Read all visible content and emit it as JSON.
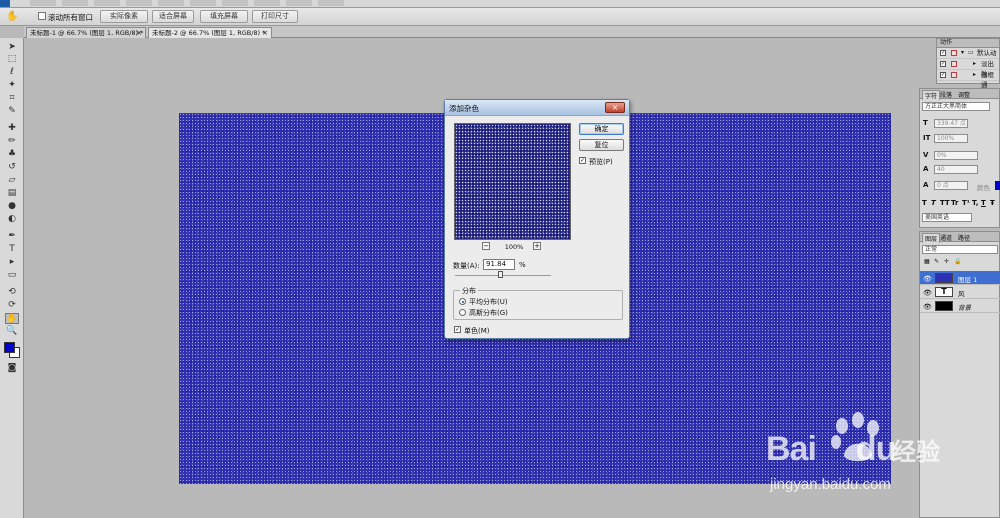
{
  "options_bar": {
    "scroll_all_windows_label": "滚动所有窗口",
    "buttons": [
      "实际像素",
      "适合屏幕",
      "填充屏幕",
      "打印尺寸"
    ]
  },
  "doc_tabs": [
    {
      "label": "未标题-1 @ 66.7% (图层 1, RGB/8) *",
      "close": "×"
    },
    {
      "label": "未标题-2 @ 66.7% (图层 1, RGB/8) *",
      "close": "×"
    }
  ],
  "colors": {
    "foreground": "#0000cc",
    "background": "#ffffff",
    "canvas": "#2e2fb2"
  },
  "dialog": {
    "title": "添加杂色",
    "close": "×",
    "ok_label": "确定",
    "reset_label": "复位",
    "preview_label": "预览(P)",
    "preview_checked": true,
    "zoom_minus": "−",
    "zoom_plus": "+",
    "zoom": "100%",
    "amount_label": "数量(A):",
    "amount_value": "91.84",
    "amount_unit": "%",
    "amount_max_percent": 400,
    "distribution_label": "分布",
    "uniform_label": "平均分布(U)",
    "gaussian_label": "高斯分布(G)",
    "selected_distribution": "uniform",
    "monochromatic_label": "单色(M)",
    "monochromatic_checked": true
  },
  "actions_panel": {
    "tab": "动作",
    "items": [
      {
        "checked": true,
        "label": "默认动"
      },
      {
        "checked": true,
        "label": "淡出效"
      },
      {
        "checked": true,
        "label": "画框通"
      }
    ]
  },
  "character_panel": {
    "tabs": [
      "字符",
      "段落",
      "调整"
    ],
    "font_family": "方正正大黑简体",
    "font_size": "339.47 点",
    "vertical_scale": "100%",
    "tracking_percent": "0%",
    "tracking": "40",
    "baseline_shift": "0 点",
    "color_label": "颜色",
    "language": "美国英语",
    "style_buttons": [
      "T",
      "T",
      "TT",
      "Tr",
      "T¹",
      "T,",
      "T",
      "Ŧ"
    ]
  },
  "layers_panel": {
    "tabs": [
      "图层",
      "通道",
      "路径"
    ],
    "blend_mode": "正常",
    "layers": [
      {
        "name": "图层 1",
        "selected": true,
        "thumb": "#2e2fb2"
      },
      {
        "name": "风",
        "selected": false,
        "thumb": "text",
        "glyph": "T"
      },
      {
        "name": "背景",
        "selected": false,
        "thumb": "#000000"
      }
    ]
  },
  "watermark": {
    "brand": "Bai",
    "brand_suffix": "du",
    "cn": "经验",
    "url": "jingyan.baidu.com"
  }
}
